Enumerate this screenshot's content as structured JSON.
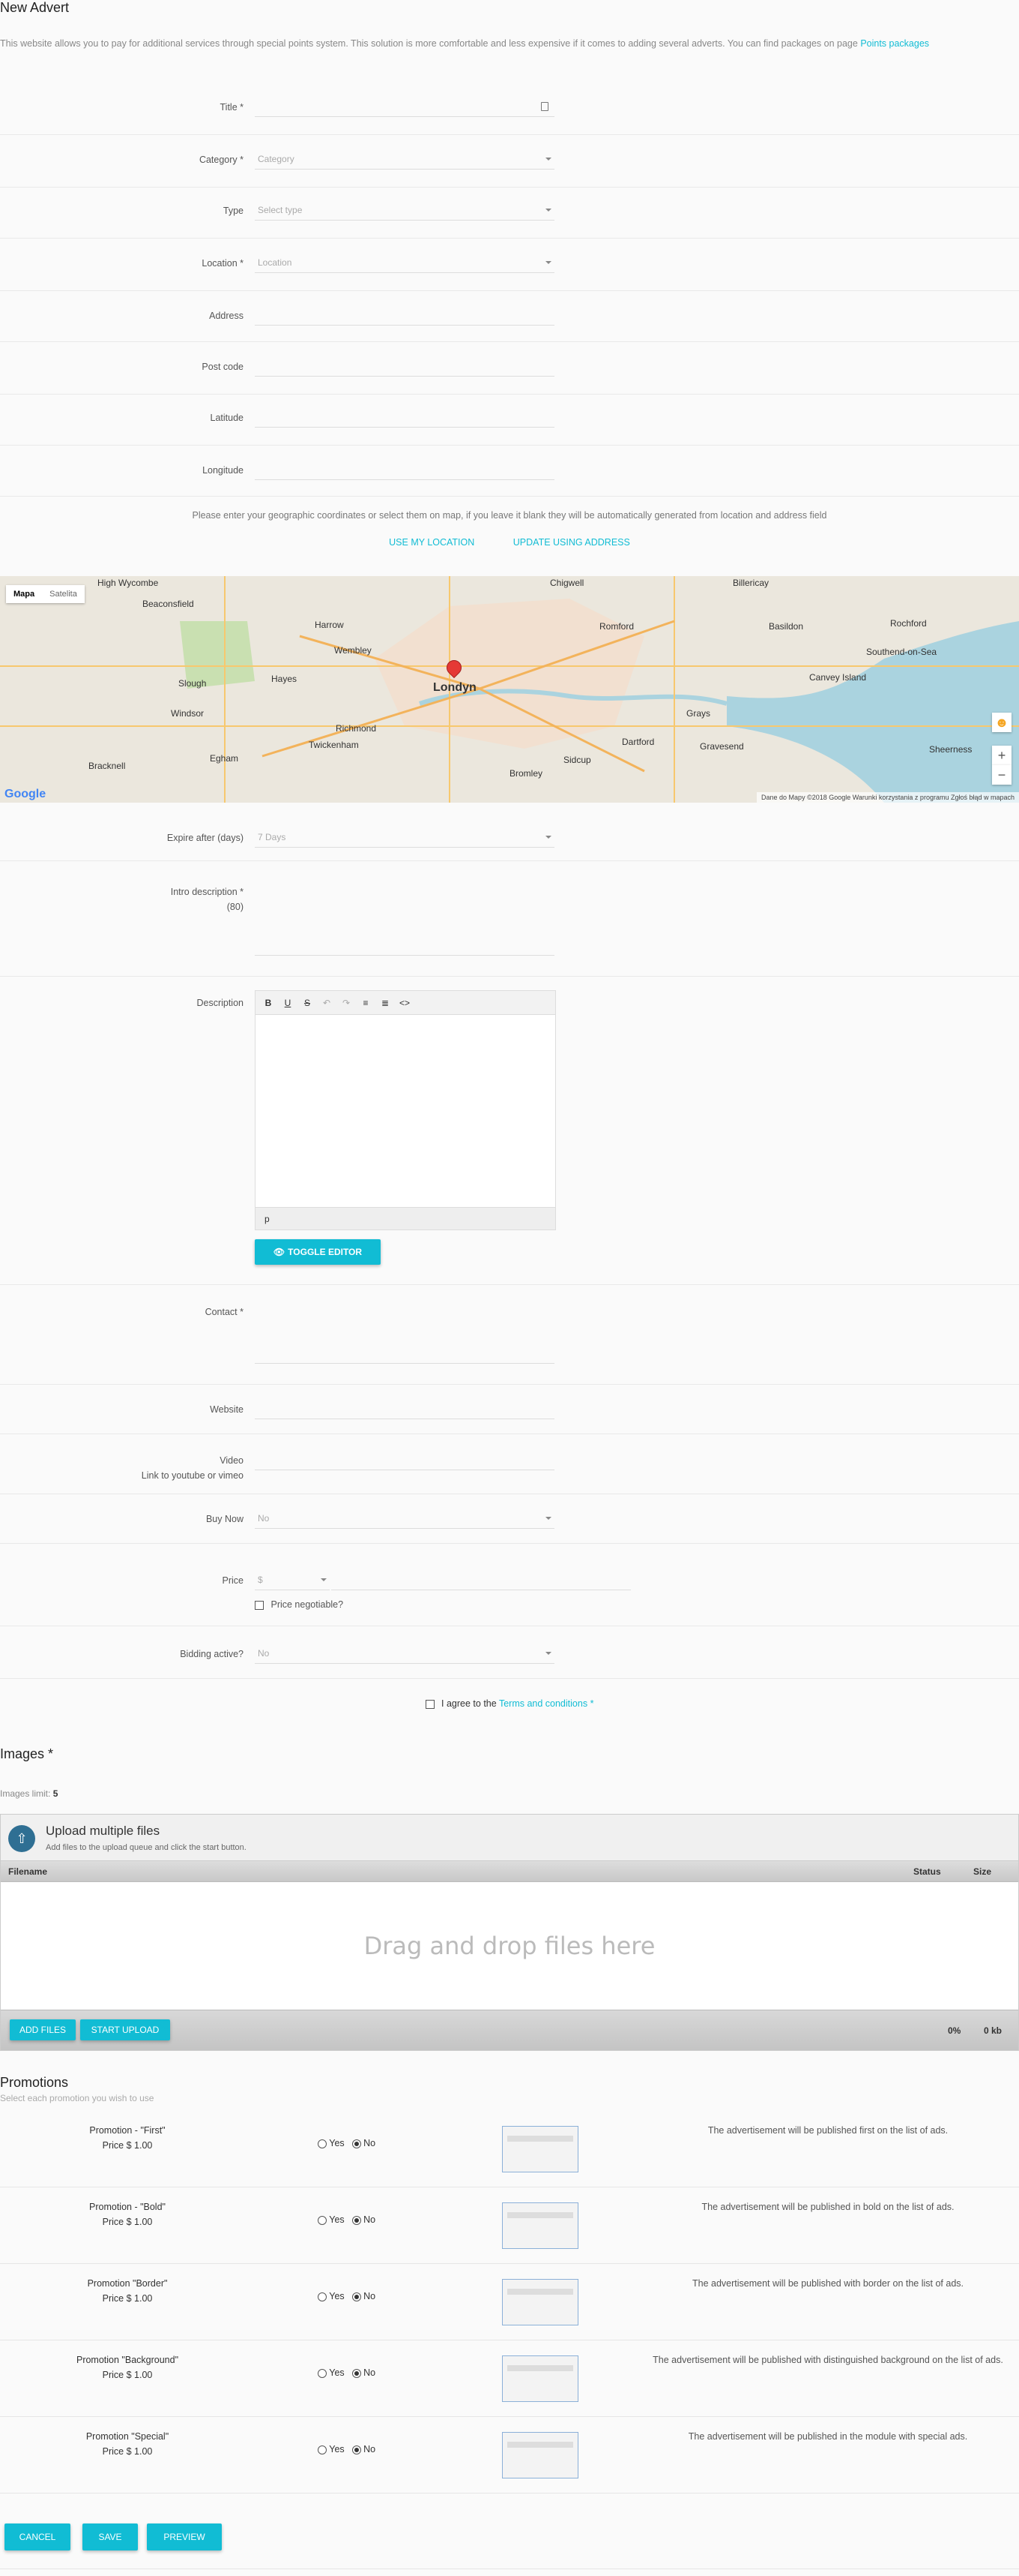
{
  "page": {
    "title": "New Advert",
    "intro": "This website allows you to pay for additional services through special points system. This solution is more comfortable and less expensive if it comes to adding several adverts. You can find packages on page ",
    "intro_link": "Points packages"
  },
  "fields": {
    "title_label": "Title *",
    "category_label": "Category *",
    "category_placeholder": "Category",
    "type_label": "Type",
    "type_placeholder": "Select type",
    "location_label": "Location *",
    "location_placeholder": "Location",
    "address_label": "Address",
    "postcode_label": "Post code",
    "latitude_label": "Latitude",
    "longitude_label": "Longitude"
  },
  "geo": {
    "note": "Please enter your geographic coordinates or select them on map, if you leave it blank they will be automatically generated from location and address field",
    "use_location": "USE MY LOCATION",
    "update_address": "UPDATE USING ADDRESS"
  },
  "map": {
    "tab_map": "Mapa",
    "tab_satellite": "Satelita",
    "center_label": "Londyn",
    "places": [
      "High Wycombe",
      "Beaconsfield",
      "Harrow",
      "Wembley",
      "Romford",
      "Basildon",
      "Southend-on-Sea",
      "Slough",
      "Hayes",
      "Windsor",
      "Richmond",
      "Twickenham",
      "Dartford",
      "Gravesend",
      "Grays",
      "Bracknell",
      "Bromley",
      "Sidcup",
      "Chigwell",
      "Billericay",
      "Rochford",
      "Canvey Island",
      "Sheerness",
      "Egham"
    ],
    "footer": "Dane do Mapy ©2018 Google   Warunki korzystania z programu   Zgłoś błąd w mapach",
    "logo": "Google",
    "zoom_in": "+",
    "zoom_out": "−"
  },
  "expire": {
    "label": "Expire after (days)",
    "value": "7 Days"
  },
  "intro_desc": {
    "label": "Intro description *",
    "count": "(80)"
  },
  "description": {
    "label": "Description",
    "toolbar": [
      "B",
      "U",
      "S",
      "↶",
      "↷",
      "≡",
      "≣",
      "<>"
    ],
    "status": "p",
    "toggle": "TOGGLE EDITOR"
  },
  "contact": {
    "label": "Contact *"
  },
  "website": {
    "label": "Website"
  },
  "video": {
    "label": "Video",
    "sub": "Link to youtube or vimeo"
  },
  "buy_now": {
    "label": "Buy Now",
    "value": "No"
  },
  "price": {
    "label": "Price",
    "currency": "$",
    "negotiable": "Price negotiable?"
  },
  "bidding": {
    "label": "Bidding active?",
    "value": "No"
  },
  "terms": {
    "prefix": "I agree to the",
    "link": "Terms and conditions",
    "req": "*"
  },
  "images": {
    "title": "Images *",
    "limit_label": "Images limit:",
    "limit_value": "5",
    "upload_title": "Upload multiple files",
    "upload_sub": "Add files to the upload queue and click the start button.",
    "col_filename": "Filename",
    "col_status": "Status",
    "col_size": "Size",
    "drop": "Drag and drop files here",
    "add_files": "ADD FILES",
    "start_upload": "START UPLOAD",
    "percent": "0%",
    "size": "0 kb"
  },
  "promotions": {
    "title": "Promotions",
    "subtitle": "Select each promotion you wish to use",
    "yes": "Yes",
    "no": "No",
    "items": [
      {
        "name": "Promotion - \"First\"",
        "price": "Price $ 1.00",
        "desc": "The advertisement will be published first on the list of ads."
      },
      {
        "name": "Promotion - \"Bold\"",
        "price": "Price $ 1.00",
        "desc": "The advertisement will be published in bold on the list of ads."
      },
      {
        "name": "Promotion \"Border\"",
        "price": "Price $ 1.00",
        "desc": "The advertisement will be published with border on the list of ads."
      },
      {
        "name": "Promotion \"Background\"",
        "price": "Price $ 1.00",
        "desc": "The advertisement will be published with distinguished background on the list of ads."
      },
      {
        "name": "Promotion \"Special\"",
        "price": "Price $ 1.00",
        "desc": "The advertisement will be published in the module with special ads."
      }
    ]
  },
  "actions": {
    "cancel": "CANCEL",
    "save": "SAVE",
    "preview": "PREVIEW"
  }
}
